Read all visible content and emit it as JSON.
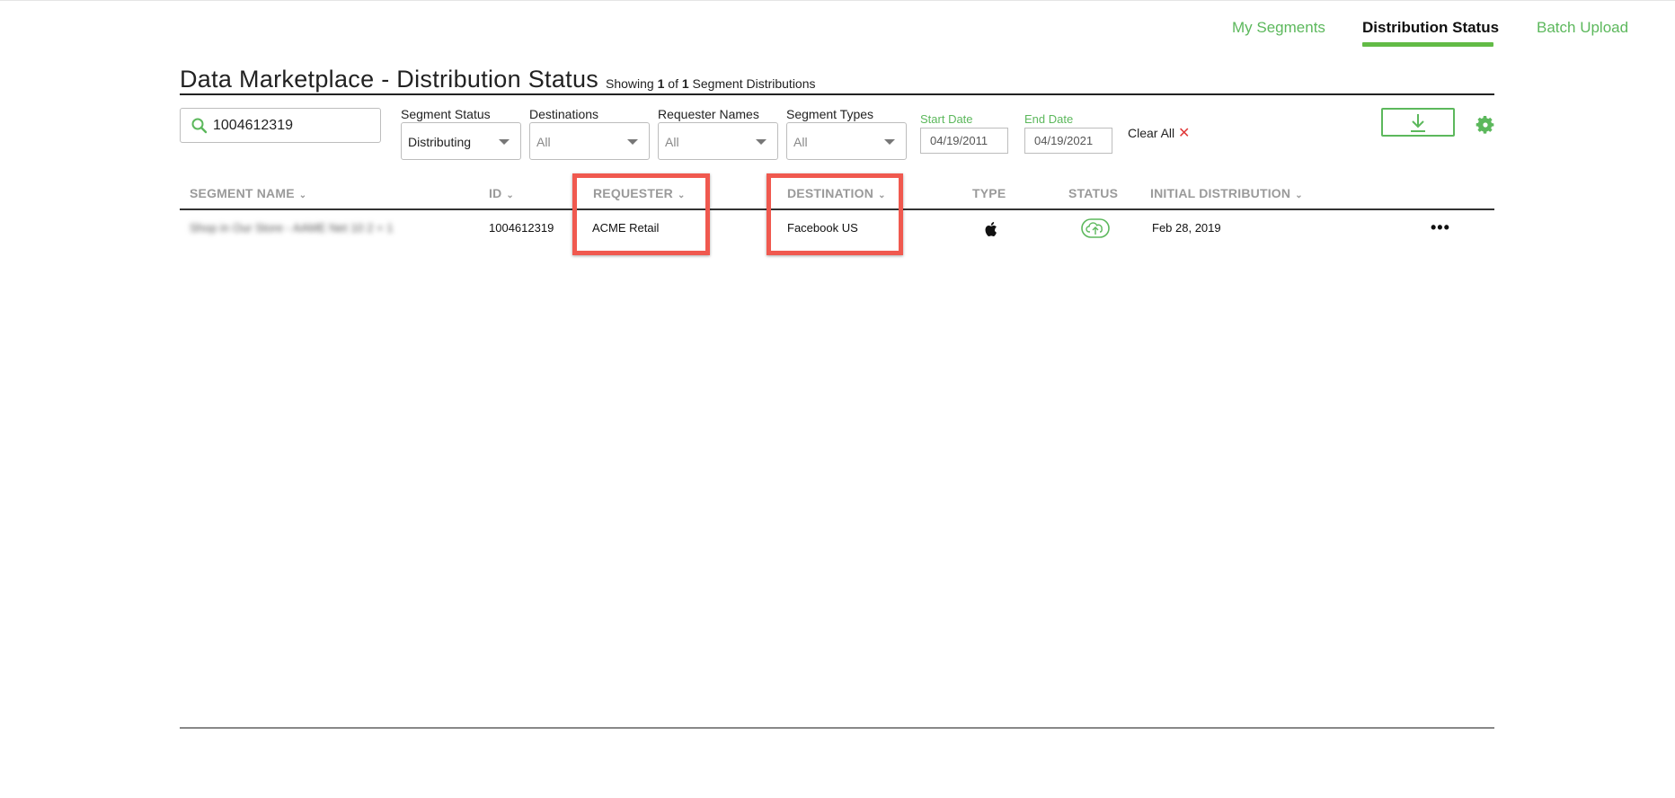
{
  "nav": {
    "items": [
      {
        "label": "My Segments"
      },
      {
        "label": "Distribution Status"
      },
      {
        "label": "Batch Upload"
      }
    ]
  },
  "header": {
    "title": "Data Marketplace - Distribution Status",
    "showing_prefix": "Showing",
    "showing_count": "1",
    "showing_of": "of",
    "showing_total": "1",
    "showing_suffix": "Segment Distributions"
  },
  "filters": {
    "search_value": "1004612319",
    "segment_status": {
      "label": "Segment Status",
      "value": "Distributing"
    },
    "destinations": {
      "label": "Destinations",
      "value": "All"
    },
    "requester_names": {
      "label": "Requester Names",
      "value": "All"
    },
    "segment_types": {
      "label": "Segment Types",
      "value": "All"
    },
    "start_date": {
      "label": "Start Date",
      "value": "04/19/2011"
    },
    "end_date": {
      "label": "End Date",
      "value": "04/19/2021"
    },
    "clear_all": "Clear All",
    "clear_icon": "✕"
  },
  "table": {
    "columns": [
      {
        "label": "SEGMENT NAME",
        "sortable": true
      },
      {
        "label": "ID",
        "sortable": true
      },
      {
        "label": "REQUESTER",
        "sortable": true
      },
      {
        "label": "DESTINATION",
        "sortable": true
      },
      {
        "label": "TYPE",
        "sortable": false
      },
      {
        "label": "STATUS",
        "sortable": false
      },
      {
        "label": "INITIAL DISTRIBUTION",
        "sortable": true
      }
    ],
    "sort_glyph": "⌄",
    "rows": [
      {
        "segment_name": "Shop in Our Store - AAME Net 10 2 + 1",
        "id": "1004612319",
        "requester": "ACME Retail",
        "destination": "Facebook US",
        "type_icon": "apple-icon",
        "status_icon": "cloud-upload-icon",
        "initial_distribution": "Feb 28, 2019",
        "more": "•••"
      }
    ]
  },
  "colors": {
    "accent": "#5cb85c",
    "highlight": "#f0594f",
    "clear": "#e03a3a"
  }
}
